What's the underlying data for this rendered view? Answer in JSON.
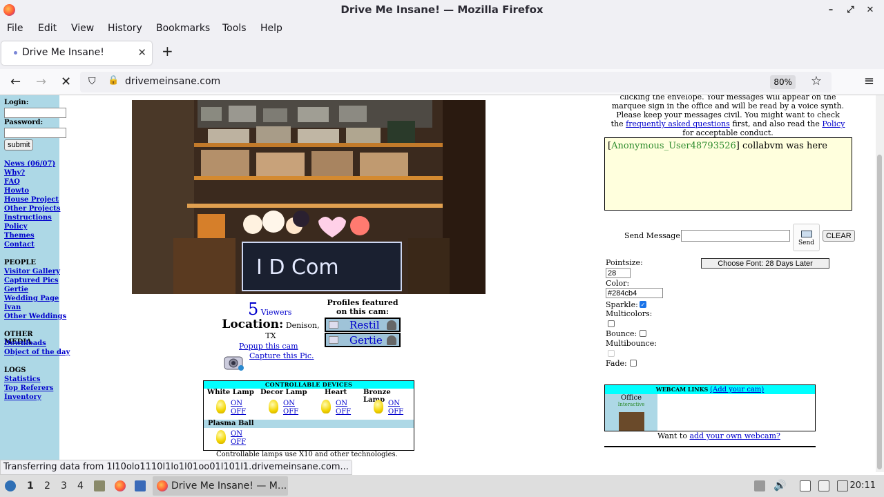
{
  "window": {
    "title": "Drive Me Insane! — Mozilla Firefox"
  },
  "menubar": [
    "File",
    "Edit",
    "View",
    "History",
    "Bookmarks",
    "Tools",
    "Help"
  ],
  "tab": {
    "title": "Drive Me Insane!"
  },
  "urlbar": {
    "url": "drivemeinsane.com",
    "zoom": "80%"
  },
  "leftnav": {
    "login_label": "Login:",
    "password_label": "Password:",
    "submit_label": "submit",
    "links": [
      "News (06/07)",
      "Why?",
      "FAQ",
      "Howto",
      "House Project",
      "Other Projects",
      "Instructions",
      "Policy",
      "Themes",
      "Contact"
    ],
    "people_heading": "PEOPLE",
    "people_links": [
      "Visitor Gallery",
      "Captured Pics",
      "Gertie",
      "Wedding Page",
      "Ivan",
      "Other Weddings"
    ],
    "media_heading": "OTHER MEDIA",
    "media_links": [
      "Downloads",
      "Object of the day"
    ],
    "logs_heading": "LOGS",
    "logs_links": [
      "Statistics",
      "Top Referers",
      "Inventory"
    ]
  },
  "cam": {
    "viewers_count": "5",
    "viewers_label": "Viewers",
    "location_label": "Location:",
    "location_value": "Denison, TX",
    "popup_link": "Popup this cam",
    "capture_link": "Capture this Pic.",
    "profiles_heading": "Profiles featured on this cam:",
    "profiles": [
      "Restil",
      "Gertie"
    ]
  },
  "devices": {
    "heading": "CONTROLLABLE DEVICES",
    "items": [
      "White Lamp",
      "Decor Lamp",
      "Heart",
      "Bronze Lamp",
      "Plasma Ball"
    ],
    "on_label": "ON",
    "off_label": "OFF",
    "note": "Controllable lamps use X10 and other technologies."
  },
  "info": {
    "line1": "clicking the envelope. Your messages will appear on the",
    "line2": "marquee sign in the office and will be read by a voice synth.",
    "line3": "Please keep your messages civil. You might want to check",
    "line4_pre": "the ",
    "faq_link": "frequently asked questions",
    "line4_mid": " first, and also read the ",
    "policy_link": "Policy",
    "line5": "for acceptable conduct."
  },
  "marquee": {
    "user": "Anonymous_User48793526",
    "message": " collabvm was here"
  },
  "message": {
    "send_label": "Send Message:",
    "send_button": "Send",
    "clear_button": "CLEAR",
    "font_button": "Choose Font: 28 Days Later",
    "pointsize_label": "Pointsize:",
    "pointsize_value": "28",
    "color_label": "Color:",
    "color_value": "#284cb4",
    "sparkle_label": "Sparkle:",
    "multicolors_label": "Multicolors:",
    "bounce_label": "Bounce:",
    "multibounce_label": "Multibounce:",
    "fade_label": "Fade:"
  },
  "webcam_links": {
    "heading": "WEBCAM LINKS",
    "add_link": "(Add your cam)",
    "cam_name": "Office",
    "cam_type": "Interactive",
    "want_pre": "Want to ",
    "want_link": "add your own webcam?"
  },
  "status": {
    "text": "Transferring data from 1l10olo1110l1lo1l01oo01l101l1.drivemeinsane.com..."
  },
  "taskbar": {
    "workspaces": [
      "1",
      "2",
      "3",
      "4"
    ],
    "task_title": "Drive Me Insane! — M...",
    "clock": "20:11"
  }
}
